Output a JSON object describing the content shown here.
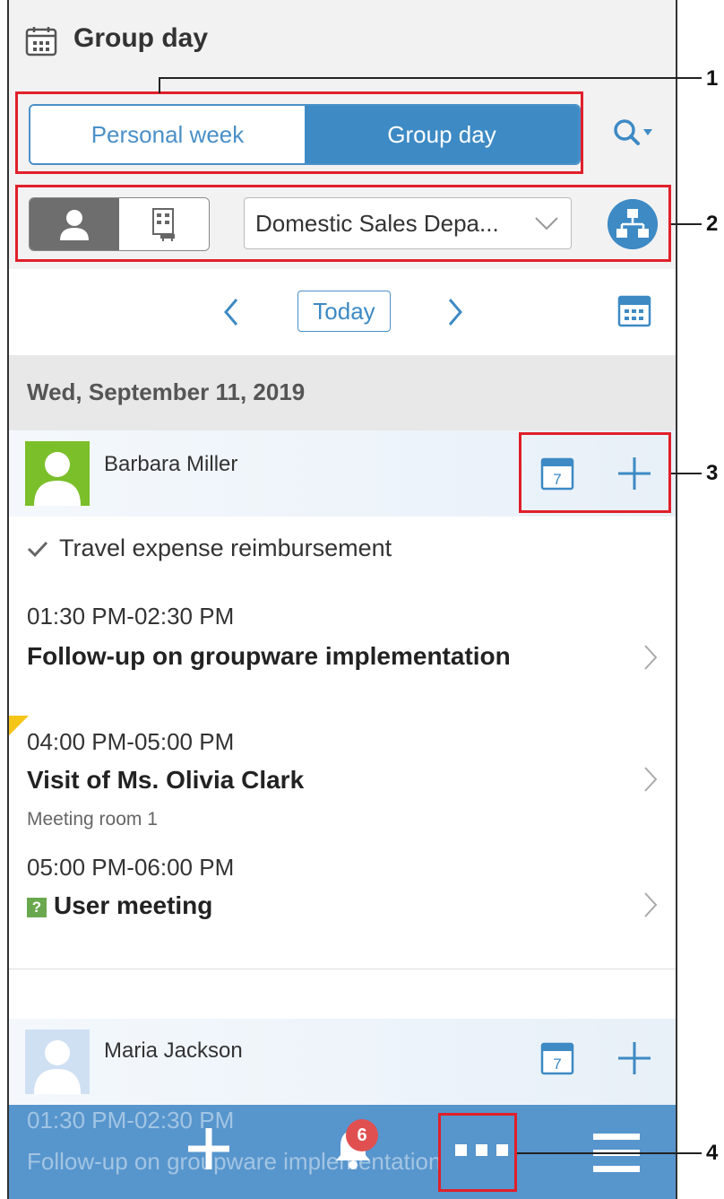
{
  "header": {
    "title": "Group day"
  },
  "view_tabs": {
    "personal_week": "Personal week",
    "group_day": "Group day",
    "active": "Group day"
  },
  "filter": {
    "department": "Domestic Sales Depa..."
  },
  "date_nav": {
    "today_label": "Today"
  },
  "date_header": "Wed, September 11, 2019",
  "users": [
    {
      "name": "Barbara Miller",
      "todo": "Travel expense reimbursement",
      "calendar_day": "7",
      "events": [
        {
          "time": "01:30 PM-02:30 PM",
          "title": "Follow-up on groupware implementation",
          "place": ""
        },
        {
          "time": "04:00 PM-05:00 PM",
          "title": "Visit of Ms. Olivia Clark",
          "place": "Meeting room 1"
        },
        {
          "time": "05:00 PM-06:00 PM",
          "title": "User meeting",
          "place": "",
          "badge": "?"
        }
      ]
    },
    {
      "name": "Maria Jackson",
      "calendar_day": "7",
      "events": [
        {
          "time": "01:30 PM-02:30 PM",
          "title": "Follow-up on groupware implementation"
        }
      ]
    }
  ],
  "bottom_bar": {
    "notification_count": "6"
  },
  "callouts": [
    "1",
    "2",
    "3",
    "4"
  ],
  "colors": {
    "accent": "#3d8ac4",
    "callout": "#e0202a",
    "badge": "#e05050"
  }
}
